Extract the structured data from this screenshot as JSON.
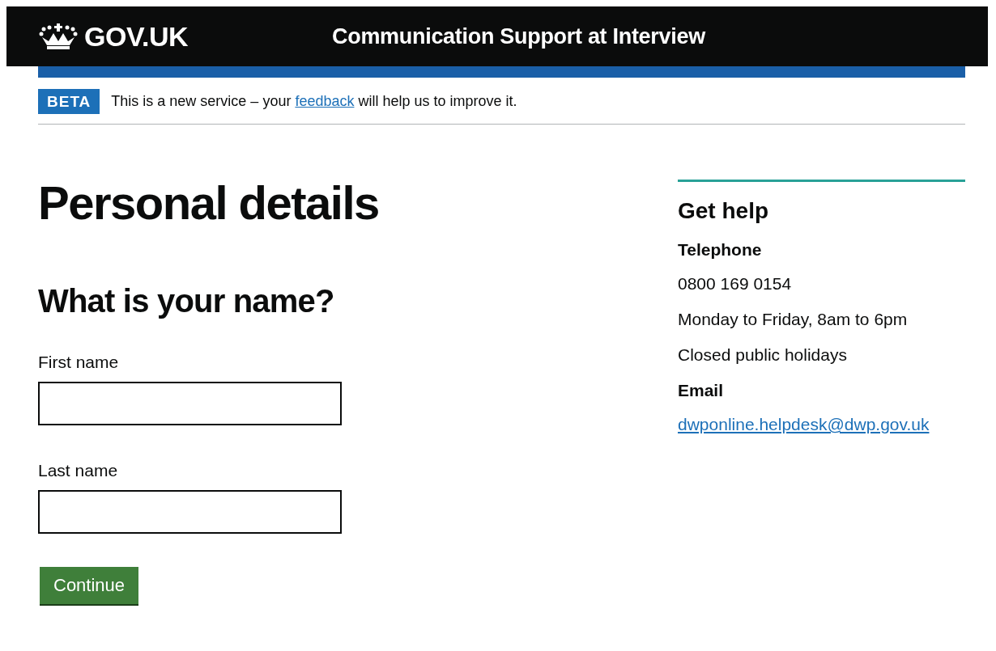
{
  "header": {
    "logo": "GOV.UK",
    "service_name": "Communication Support at Interview"
  },
  "phase_banner": {
    "tag": "BETA",
    "text_before": "This is a new service – your ",
    "link": "feedback",
    "text_after": " will help us to improve it."
  },
  "main": {
    "title": "Personal details",
    "question": "What is your name?",
    "fields": [
      {
        "label": "First name"
      },
      {
        "label": "Last name"
      }
    ],
    "button": "Continue"
  },
  "sidebar": {
    "title": "Get help",
    "sections": [
      {
        "heading": "Telephone",
        "lines": [
          {
            "kind": "text",
            "text": "0800 169 0154"
          },
          {
            "kind": "text",
            "text": "Monday to Friday, 8am to 6pm"
          },
          {
            "kind": "text",
            "text": "Closed public holidays"
          }
        ]
      },
      {
        "heading": "Email",
        "lines": [
          {
            "kind": "link",
            "text": "dwponline.helpdesk@dwp.gov.uk"
          }
        ]
      }
    ]
  }
}
